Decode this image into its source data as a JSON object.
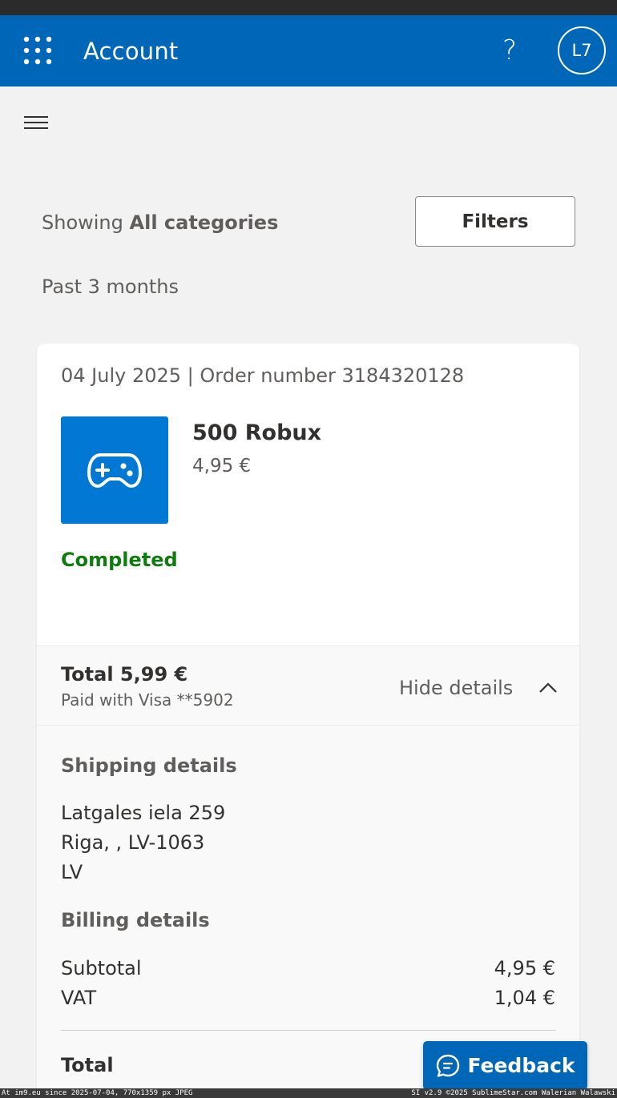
{
  "app_bar": {
    "title": "Account",
    "help_label": "?",
    "avatar_initials": "L7",
    "background_color": "#0067b8",
    "waffle_icon": "waffle-grid-icon"
  },
  "filter_bar": {
    "showing_prefix": "Showing",
    "showing_category": "All categories",
    "filters_label": "Filters",
    "period_label": "Past 3 months"
  },
  "order": {
    "header": "04 July 2025 | Order number 3184320128",
    "product": {
      "name": "500 Robux",
      "price": "4,95 €",
      "icon": "game-controller-icon",
      "tile_color": "#0078d4"
    },
    "status": "Completed",
    "status_color": "#107c10",
    "summary": {
      "total": "Total 5,99 €",
      "paid_with": "Paid with Visa **5902",
      "toggle_label": "Hide details",
      "toggle_icon": "chevron-up-icon"
    },
    "shipping": {
      "title": "Shipping details",
      "lines": [
        "Latgales iela 259",
        "Riga, , LV-1063",
        "LV"
      ]
    },
    "billing": {
      "title": "Billing details",
      "rows": [
        {
          "label": "Subtotal",
          "value": "4,95 €"
        },
        {
          "label": "VAT",
          "value": "1,04 €"
        }
      ],
      "total_label": "Total"
    }
  },
  "feedback": {
    "label": "Feedback",
    "icon": "chat-bubble-icon"
  },
  "watermark": {
    "left": "At im9.eu since 2025-07-04, 770x1359 px JPEG",
    "right": "SI v2.9 ©2025 SublimeStar.com Walerian Walawski"
  }
}
